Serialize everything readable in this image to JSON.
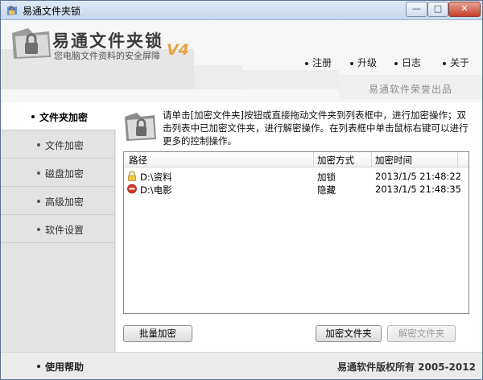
{
  "window": {
    "title": "易通文件夹锁",
    "min_symbol": "—",
    "max_symbol": "□",
    "close_symbol": "✕",
    "icon": "app-folder-lock-icon"
  },
  "header": {
    "logo_title": "易通文件夹锁",
    "logo_subtitle": "您电脑文件资料的安全屏障",
    "version": "V4",
    "nav": [
      "注册",
      "升级",
      "日志",
      "关于"
    ],
    "brand": "易通软件荣誉出品"
  },
  "sidebar": {
    "items": [
      {
        "label": "文件夹加密",
        "active": true
      },
      {
        "label": "文件加密",
        "active": false
      },
      {
        "label": "磁盘加密",
        "active": false
      },
      {
        "label": "高级加密",
        "active": false
      },
      {
        "label": "软件设置",
        "active": false
      }
    ]
  },
  "main": {
    "info": "请单击[加密文件夹]按钮或直接拖动文件夹到列表框中，进行加密操作；双击列表中已加密文件夹，进行解密操作。在列表框中单击鼠标右键可以进行更多的控制操作。",
    "columns": [
      "路径",
      "加密方式",
      "加密时间"
    ],
    "rows": [
      {
        "path": "D:\\资料",
        "method": "加锁",
        "time": "2013/1/5 21:48:22",
        "icon": "lock-icon"
      },
      {
        "path": "D:\\电影",
        "method": "隐藏",
        "time": "2013/1/5 21:48:35",
        "icon": "hidden-icon"
      }
    ],
    "buttons": {
      "batch": "批量加密",
      "encrypt": "加密文件夹",
      "decrypt": "解密文件夹"
    }
  },
  "footer": {
    "help": "使用帮助",
    "copyright": "易通软件版权所有 2005-2012"
  },
  "colors": {
    "accent_orange": "#e8a33a",
    "titlebar": "#c6d7ec",
    "close_red": "#c4412b"
  }
}
